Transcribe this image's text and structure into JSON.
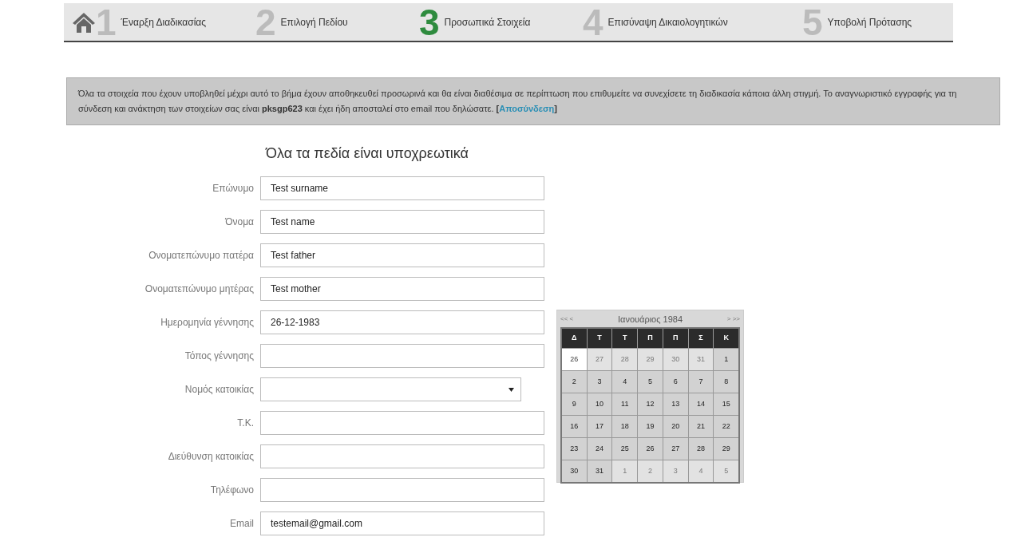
{
  "steps": [
    {
      "number": "1",
      "label": "Έναρξη Διαδικασίας",
      "selected": false
    },
    {
      "number": "2",
      "label": "Επιλογή Πεδίου",
      "selected": false
    },
    {
      "number": "3",
      "label": "Προσωπικά Στοιχεία",
      "selected": true
    },
    {
      "number": "4",
      "label": "Επισύναψη Δικαιολογητικών",
      "selected": false
    },
    {
      "number": "5",
      "label": "Υποβολή Πρότασης",
      "selected": false
    }
  ],
  "notice": {
    "text": "Όλα τα στοιχεία που έχουν υποβληθεί μέχρι αυτό το βήμα έχουν αποθηκευθεί προσωρινά και θα είναι διαθέσιμα σε περίπτωση που επιθυμείτε να συνεχίσετε τη διαδικασία κάποια άλλη στιγμή. Το αναγνωριστικό εγγραφής για τη σύνδεση και ανάκτηση των στοιχείων σας είναι **pksgp623** και έχει ήδη αποσταλεί στο email που δηλώσατε.",
    "link_open": "[",
    "link": "Αποσύνδεση",
    "link_close": "]"
  },
  "form": {
    "heading": "Όλα τα πεδία είναι υποχρεωτικά",
    "fields": [
      {
        "label": "Επώνυμο",
        "kind": "text",
        "value": "Test surname"
      },
      {
        "label": "Όνομα",
        "kind": "text",
        "value": "Test name"
      },
      {
        "label": "Ονοματεπώνυμο πατέρα",
        "kind": "text",
        "value": "Test father"
      },
      {
        "label": "Ονοματεπώνυμο μητέρας",
        "kind": "text",
        "value": "Test mother"
      },
      {
        "label": "Ημερομηνία γέννησης",
        "kind": "text",
        "value": "26-12-1983"
      },
      {
        "label": "Τόπος γέννησης",
        "kind": "text"
      },
      {
        "label": "Νομός κατοικίας",
        "kind": "select"
      },
      {
        "label": "Τ.Κ.",
        "kind": "text"
      },
      {
        "label": "Διεύθυνση κατοικίας",
        "kind": "text"
      },
      {
        "label": "Τηλέφωνο",
        "kind": "text"
      },
      {
        "label": "Email",
        "kind": "text",
        "value": "testemail@gmail.com"
      }
    ]
  },
  "calendar": {
    "prev": "<< <",
    "title": "Ιανουάριος 1984",
    "next": "> >>",
    "weekdays": [
      "Δ",
      "Τ",
      "Τ",
      "Π",
      "Π",
      "Σ",
      "Κ"
    ],
    "weeks": [
      [
        {
          "day": "26",
          "outside": true,
          "selected": true
        },
        {
          "day": "27",
          "outside": true,
          "selected": false
        },
        {
          "day": "28",
          "outside": true,
          "selected": false
        },
        {
          "day": "29",
          "outside": true,
          "selected": false
        },
        {
          "day": "30",
          "outside": true,
          "selected": false
        },
        {
          "day": "31",
          "outside": true,
          "selected": false
        },
        {
          "day": "1",
          "outside": false,
          "selected": false
        }
      ],
      [
        {
          "day": "2",
          "outside": false,
          "selected": false
        },
        {
          "day": "3",
          "outside": false,
          "selected": false
        },
        {
          "day": "4",
          "outside": false,
          "selected": false
        },
        {
          "day": "5",
          "outside": false,
          "selected": false
        },
        {
          "day": "6",
          "outside": false,
          "selected": false
        },
        {
          "day": "7",
          "outside": false,
          "selected": false
        },
        {
          "day": "8",
          "outside": false,
          "selected": false
        }
      ],
      [
        {
          "day": "9",
          "outside": false,
          "selected": false
        },
        {
          "day": "10",
          "outside": false,
          "selected": false
        },
        {
          "day": "11",
          "outside": false,
          "selected": false
        },
        {
          "day": "12",
          "outside": false,
          "selected": false
        },
        {
          "day": "13",
          "outside": false,
          "selected": false
        },
        {
          "day": "14",
          "outside": false,
          "selected": false
        },
        {
          "day": "15",
          "outside": false,
          "selected": false
        }
      ],
      [
        {
          "day": "16",
          "outside": false,
          "selected": false
        },
        {
          "day": "17",
          "outside": false,
          "selected": false
        },
        {
          "day": "18",
          "outside": false,
          "selected": false
        },
        {
          "day": "19",
          "outside": false,
          "selected": false
        },
        {
          "day": "20",
          "outside": false,
          "selected": false
        },
        {
          "day": "21",
          "outside": false,
          "selected": false
        },
        {
          "day": "22",
          "outside": false,
          "selected": false
        }
      ],
      [
        {
          "day": "23",
          "outside": false,
          "selected": false
        },
        {
          "day": "24",
          "outside": false,
          "selected": false
        },
        {
          "day": "25",
          "outside": false,
          "selected": false
        },
        {
          "day": "26",
          "outside": false,
          "selected": false
        },
        {
          "day": "27",
          "outside": false,
          "selected": false
        },
        {
          "day": "28",
          "outside": false,
          "selected": false
        },
        {
          "day": "29",
          "outside": false,
          "selected": false
        }
      ],
      [
        {
          "day": "30",
          "outside": false,
          "selected": false
        },
        {
          "day": "31",
          "outside": false,
          "selected": false
        },
        {
          "day": "1",
          "outside": true,
          "selected": false
        },
        {
          "day": "2",
          "outside": true,
          "selected": false
        },
        {
          "day": "3",
          "outside": true,
          "selected": false
        },
        {
          "day": "4",
          "outside": true,
          "selected": false
        },
        {
          "day": "5",
          "outside": true,
          "selected": false
        }
      ]
    ]
  }
}
